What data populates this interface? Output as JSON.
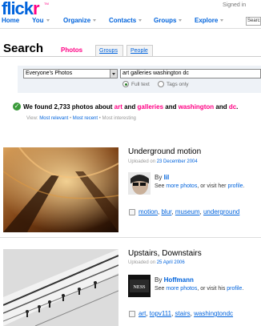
{
  "header": {
    "logo_flick": "flick",
    "logo_r": "r",
    "logo_tm": "TM",
    "signed_in": "Signed in",
    "nav": [
      {
        "label": "Home",
        "caret": false
      },
      {
        "label": "You",
        "caret": true
      },
      {
        "label": "Organize",
        "caret": true
      },
      {
        "label": "Contacts",
        "caret": true
      },
      {
        "label": "Groups",
        "caret": true
      },
      {
        "label": "Explore",
        "caret": true
      }
    ],
    "search_mini": "Search"
  },
  "search": {
    "title": "Search",
    "tabs": [
      {
        "label": "Photos",
        "active": true
      },
      {
        "label": "Groups",
        "active": false
      },
      {
        "label": "People",
        "active": false
      }
    ],
    "scope": "Everyone's Photos",
    "query": "art galleries washington dc",
    "modes": [
      {
        "label": "Full text",
        "selected": true
      },
      {
        "label": "Tags only",
        "selected": false
      }
    ]
  },
  "summary": {
    "prefix": "We found 2,733 photos about ",
    "term1": "art",
    "and1": " and ",
    "term2": "galleries",
    "and2": " and ",
    "term3": "washington",
    "and3": " and ",
    "term4": "dc",
    "suffix": ".",
    "view_label": "View:",
    "view_options": [
      "Most relevant",
      "Most recent",
      "Most interesting"
    ]
  },
  "results": [
    {
      "title": "Underground motion",
      "uploaded_prefix": "Uploaded on ",
      "uploaded_date": "23 December 2004",
      "by_prefix": "By ",
      "author": "lil",
      "more_prefix": "See ",
      "more_link": "more photos",
      "more_mid": ", or visit her ",
      "profile_link": "profile",
      "more_suffix": ".",
      "tags": [
        "motion",
        "blur",
        "museum",
        "underground"
      ]
    },
    {
      "title": "Upstairs, Downstairs",
      "uploaded_prefix": "Uploaded on ",
      "uploaded_date": "25 April 2006",
      "by_prefix": "By ",
      "author": "Hoffmann",
      "more_prefix": "See ",
      "more_link": "more photos",
      "more_mid": ", or visit his ",
      "profile_link": "profile",
      "more_suffix": ".",
      "tags": [
        "art",
        "topv111",
        "stairs",
        "washingtondc"
      ]
    }
  ],
  "colors": {
    "brand_blue": "#0063dc",
    "brand_pink": "#ff0084",
    "success_green": "#3a9a3a"
  }
}
